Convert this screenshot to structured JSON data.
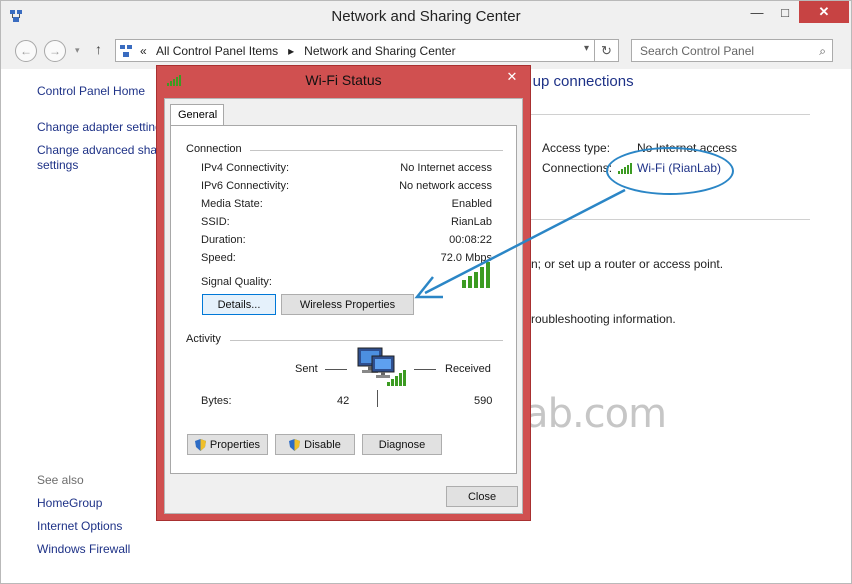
{
  "window": {
    "title": "Network and Sharing Center",
    "caption": {
      "minimize": "—",
      "maximize": "□",
      "close": "✕"
    }
  },
  "nav": {
    "back": "←",
    "forward": "→",
    "up": "↑",
    "address": {
      "prefix": "«",
      "crumb1": "All Control Panel Items",
      "separator": "▸",
      "crumb2": "Network and Sharing Center"
    },
    "search": {
      "placeholder": "Search Control Panel"
    }
  },
  "sidebar": {
    "home": "Control Panel Home",
    "items": [
      "Change adapter setting",
      "Change advanced shar",
      "settings"
    ],
    "see_also_label": "See also",
    "see_also": [
      "HomeGroup",
      "Internet Options",
      "Windows Firewall"
    ]
  },
  "content": {
    "heading": "et up connections",
    "access_type_label": "Access type:",
    "access_type_value": "No Internet access",
    "connections_label": "Connections:",
    "connections_value": "Wi-Fi (RianLab)",
    "line1": "n; or set up a router or access point.",
    "line2": "roubleshooting information."
  },
  "watermark": "RianLab.com",
  "dialog": {
    "title": "Wi-Fi Status",
    "close": "✕",
    "tab": "General",
    "connection": {
      "label": "Connection",
      "rows": [
        {
          "label": "IPv4 Connectivity:",
          "value": "No Internet access"
        },
        {
          "label": "IPv6 Connectivity:",
          "value": "No network access"
        },
        {
          "label": "Media State:",
          "value": "Enabled"
        },
        {
          "label": "SSID:",
          "value": "RianLab"
        },
        {
          "label": "Duration:",
          "value": "00:08:22"
        },
        {
          "label": "Speed:",
          "value": "72.0 Mbps"
        }
      ],
      "signal_label": "Signal Quality:"
    },
    "buttons": {
      "details": "Details...",
      "wireless": "Wireless Properties"
    },
    "activity": {
      "label": "Activity",
      "sent": "Sent",
      "received": "Received",
      "bytes_label": "Bytes:",
      "bytes_sent": "42",
      "bytes_received": "590"
    },
    "action_buttons": {
      "properties": "Properties",
      "disable": "Disable",
      "diagnose": "Diagnose"
    },
    "close_button": "Close"
  },
  "colors": {
    "link": "#1e3287",
    "dialog_frame": "#d05050",
    "annotation": "#2b86c6"
  }
}
